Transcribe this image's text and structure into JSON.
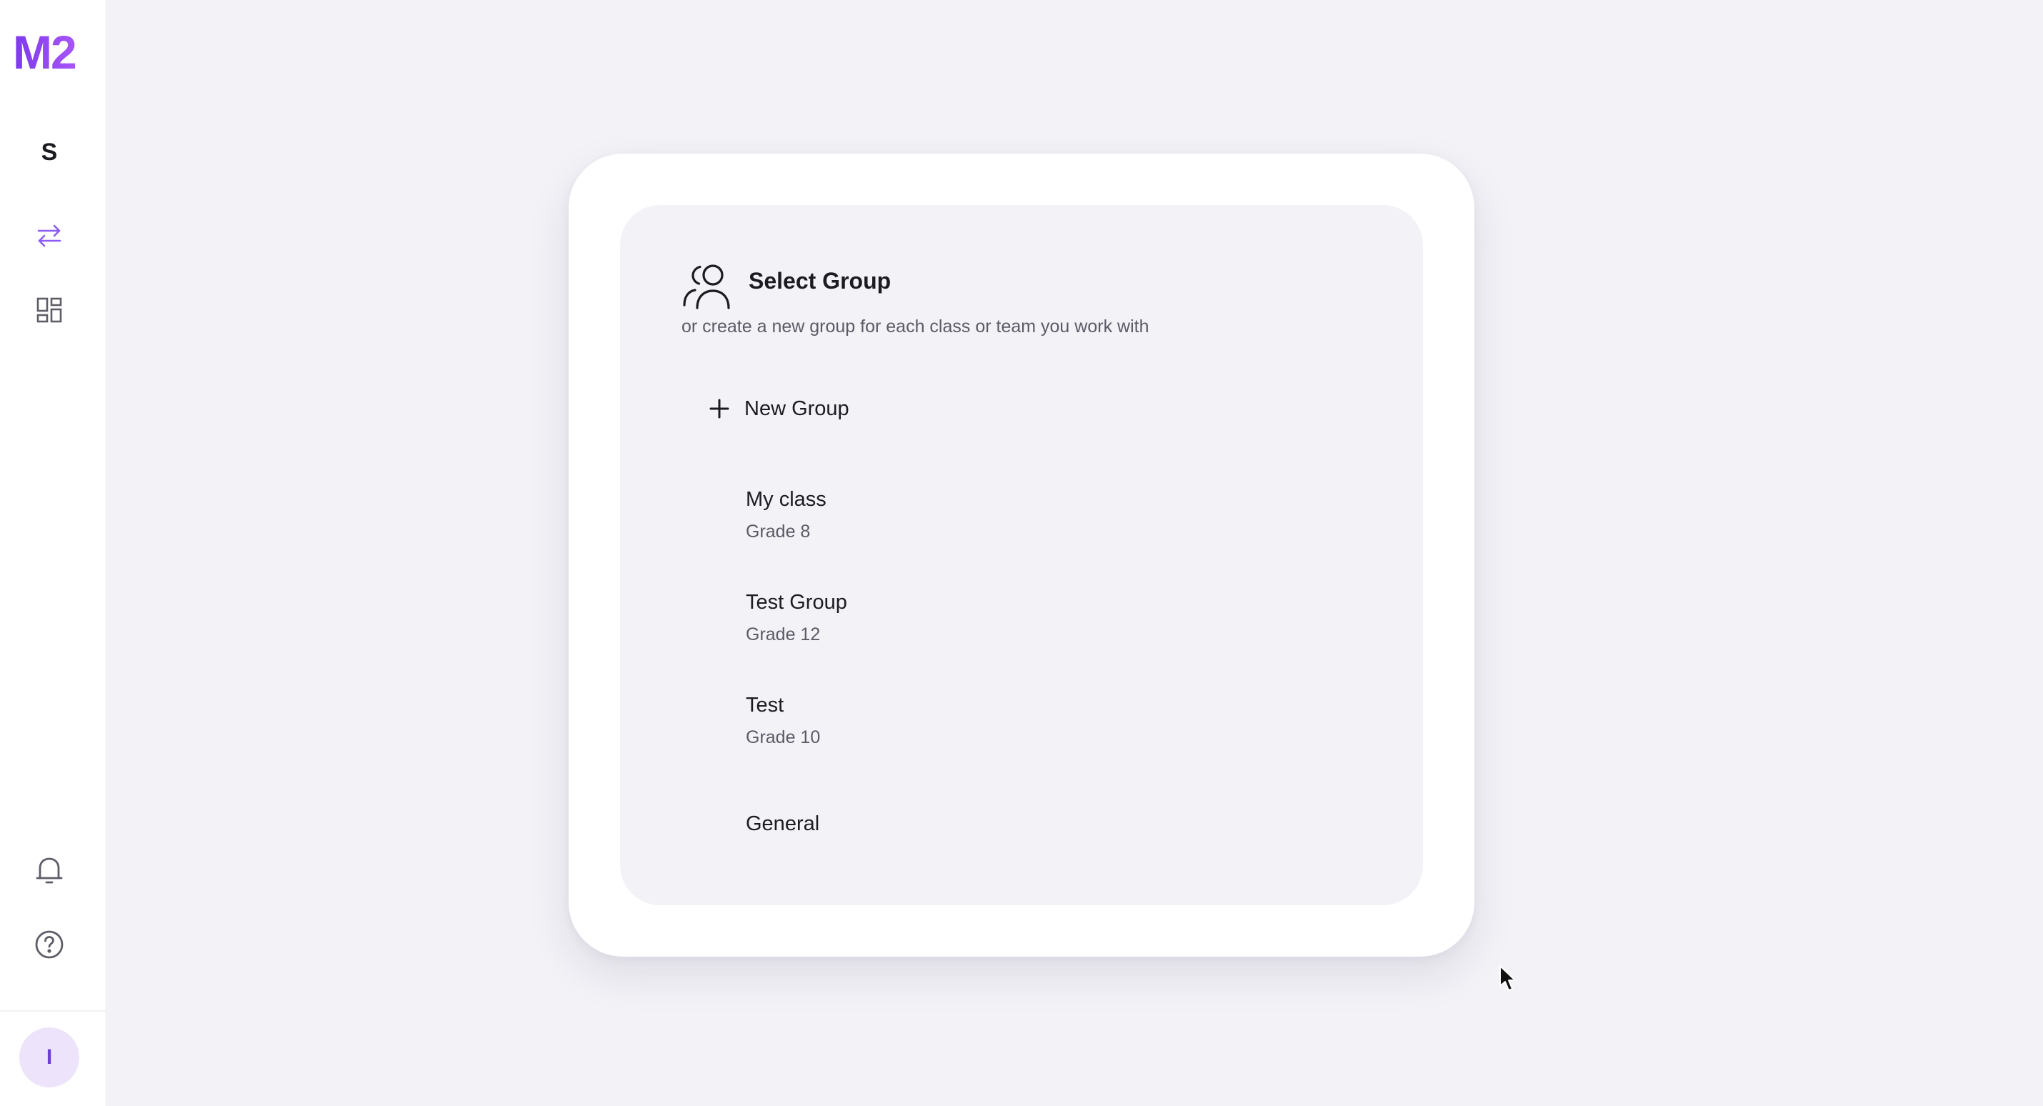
{
  "app": {
    "logo_text": "M2",
    "brand_colors": [
      "#7c3aed",
      "#a855f7"
    ]
  },
  "sidebar": {
    "workspace_initial": "S",
    "items": [
      {
        "icon": "switch-arrows-icon",
        "active": true
      },
      {
        "icon": "dashboard-grid-icon",
        "active": false
      }
    ],
    "bottom_items": [
      {
        "icon": "bell-icon"
      },
      {
        "icon": "help-circle-icon"
      }
    ],
    "avatar_initial": "I",
    "accent_color": "#7c3aed"
  },
  "dialog": {
    "icon": "users-icon",
    "title": "Select Group",
    "subtitle": "or create a new group for each class or team you work with",
    "new_group_label": "New Group",
    "groups": [
      {
        "name": "My class",
        "grade": "Grade 8"
      },
      {
        "name": "Test Group",
        "grade": "Grade 12"
      },
      {
        "name": "Test",
        "grade": "Grade 10"
      },
      {
        "name": "General",
        "grade": ""
      }
    ]
  }
}
